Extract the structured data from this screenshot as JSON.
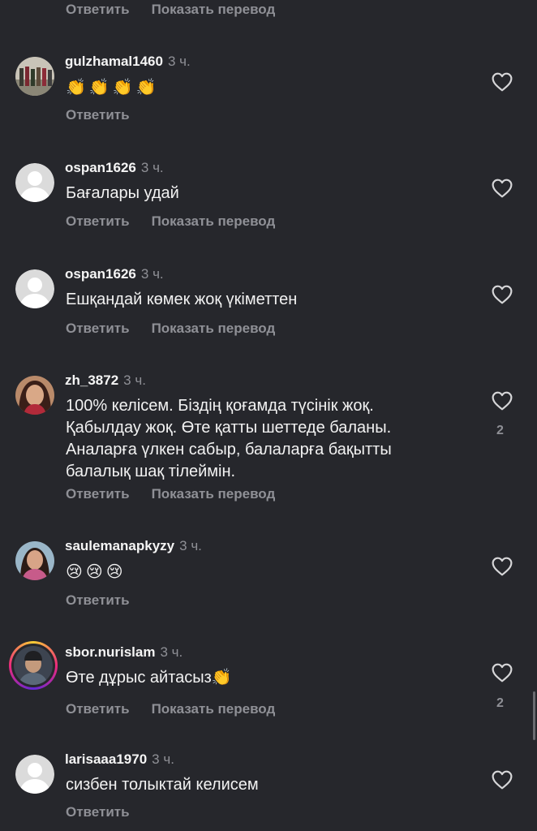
{
  "top_actions": {
    "reply": "Ответить",
    "translate": "Показать перевод"
  },
  "comments": [
    {
      "username": "gulzhamal1460",
      "time": "3 ч.",
      "text": "👏👏👏👏",
      "reply": "Ответить",
      "translate": "",
      "likes": ""
    },
    {
      "username": "ospan1626",
      "time": "3 ч.",
      "text": "Бағалары удай",
      "reply": "Ответить",
      "translate": "Показать перевод",
      "likes": ""
    },
    {
      "username": "ospan1626",
      "time": "3 ч.",
      "text": "Ешқандай көмек жоқ үкіметтен",
      "reply": "Ответить",
      "translate": "Показать перевод",
      "likes": ""
    },
    {
      "username": "zh_3872",
      "time": "3 ч.",
      "text": "100% келісем. Біздің қоғамда түсінік жоқ. Қабылдау жоқ. Өте қатты шеттеде баланы. Аналарға үлкен сабыр, балаларға бақытты балалық шақ тілеймін.",
      "reply": "Ответить",
      "translate": "Показать перевод",
      "likes": "2"
    },
    {
      "username": "saulemanapkyzy",
      "time": "3 ч.",
      "text": "😢😢😢",
      "reply": "Ответить",
      "translate": "",
      "likes": ""
    },
    {
      "username": "sbor.nurislam",
      "time": "3 ч.",
      "text": "Өте дұрыс айтасыз👏",
      "reply": "Ответить",
      "translate": "Показать перевод",
      "likes": "2"
    },
    {
      "username": "larisaaa1970",
      "time": "3 ч.",
      "text": "сизбен толыктай келисем",
      "reply": "Ответить",
      "translate": "",
      "likes": ""
    }
  ],
  "colors": {
    "background": "#26272c",
    "muted": "#8f9096",
    "text": "#f2f2f2"
  },
  "icons": {
    "like": "heart-outline-icon",
    "default_avatar": "default-avatar-icon"
  }
}
